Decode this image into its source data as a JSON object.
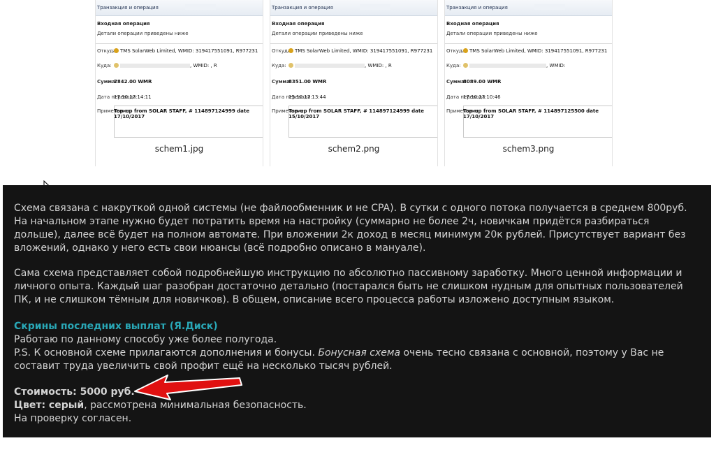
{
  "thumbnails": [
    {
      "caption": "schem1.jpg",
      "window_title": "Транзакция и операция",
      "heading": "Входная операция",
      "subheading": "Детали операции приведены ниже",
      "from_label": "Откуда:",
      "from_value": "TMS SolarWeb Limited, WMID: 319417551091, R977231",
      "to_label": "Куда:",
      "to_value": ", WMID:                , R",
      "sum_label": "Сумма:",
      "sum_value": "7842.00 WMR",
      "date_label": "Дата перевода:",
      "date_value": "17.10.17 14:11",
      "note_label": "Примечание:",
      "note_value": "Top-up from SOLAR STAFF, # 114897124999 date 17/10/2017"
    },
    {
      "caption": "schem2.png",
      "window_title": "Транзакция и операция",
      "heading": "Входная операция",
      "subheading": "Детали операции приведены ниже",
      "from_label": "Откуда:",
      "from_value": "TMS SolarWeb Limited, WMID: 319417551091, R977231",
      "to_label": "Куда:",
      "to_value": ", WMID:                , R",
      "sum_label": "Сумма:",
      "sum_value": "8351.00 WMR",
      "date_label": "Дата перевода:",
      "date_value": "15.10.17 13:44",
      "note_label": "Примечание:",
      "note_value": "Top-up from SOLAR STAFF, # 114897124999 date 15/10/2017"
    },
    {
      "caption": "schem3.png",
      "window_title": "Транзакция и операция",
      "heading": "Входная операция",
      "subheading": "Детали операции приведены ниже",
      "from_label": "Откуда:",
      "from_value": "TMS SolarWeb Limited, WMID: 319417551091, R977231",
      "to_label": "Куда:",
      "to_value": ", WMID:",
      "sum_label": "Сумма:",
      "sum_value": "8089.00 WMR",
      "date_label": "Дата перевода:",
      "date_value": "17.10.17 10:46",
      "note_label": "Примечание:",
      "note_value": "Top-up from SOLAR STAFF, # 114897125500 date 17/10/2017"
    }
  ],
  "post": {
    "para1": "Схема связана с накруткой одной системы (не файлообменник и не CPA). В сутки с одного потока получается в среднем 800руб. На начальном этапе нужно будет потратить время на настройку (суммарно не более 2ч, новичкам придётся разбираться дольше), далее всё будет на полном автомате. При вложении 2к доход в месяц минимум 20к рублей. Присутствует вариант без вложений, однако у него есть свои нюансы (всё подробно описано в мануале).",
    "para2": "Сама схема представляет собой подробнейшую инструкцию по абсолютно пассивному заработку. Много ценной информации и личного опыта. Каждый шаг разобран достаточно детально (постарался быть не слишком нудным для опытных пользователей ПК, и не слишком тёмным для новичков). В общем, описание всего процесса работы изложено доступным языком.",
    "link_text": "Скрины последних выплат (Я.Диск)",
    "line_work": "Работаю по данному способу уже более полугода.",
    "ps_prefix": "P.S. К основной схеме прилагаются дополнения и бонусы. ",
    "ps_italic": "Бонусная схема",
    "ps_suffix": " очень тесно связана с основной, поэтому у Вас не составит труда увеличить свой профит ещё на несколько тысяч рублей.",
    "price": "Стоимость: 5000 руб.",
    "color_label": "Цвет: серый",
    "color_rest": ", рассмотрена минимальная безопасность.",
    "check": "На проверку согласен."
  },
  "colors": {
    "panel_bg": "#141414",
    "text": "#d3d3d3",
    "link": "#29a7b6",
    "arrow": "#e01010"
  },
  "icons": [
    "cursor-arrow-icon",
    "red-arrow-annotation"
  ]
}
